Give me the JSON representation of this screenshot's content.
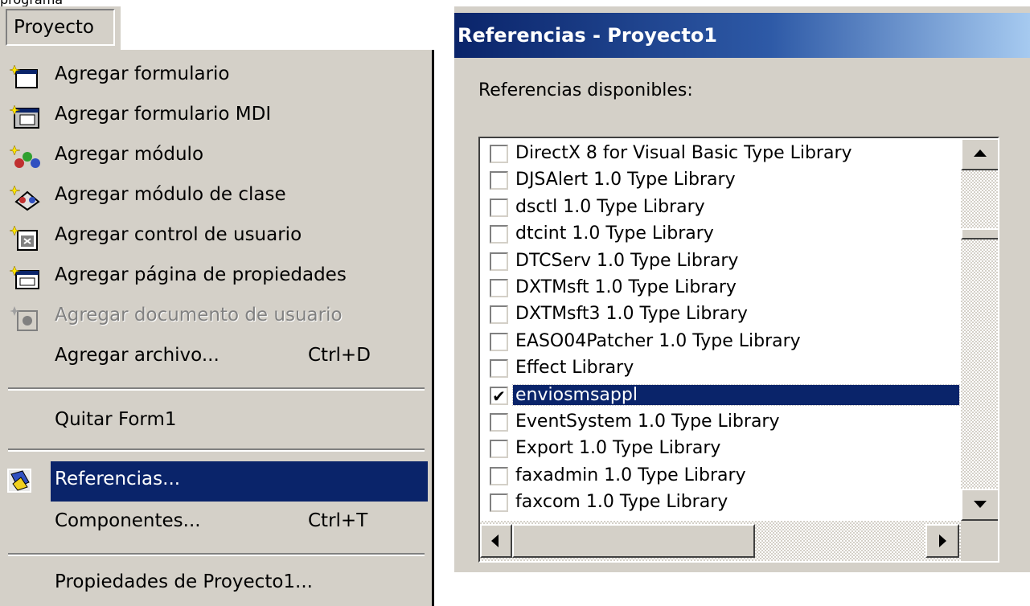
{
  "caption": "programa",
  "menubar": {
    "title": "Proyecto"
  },
  "menu": {
    "items": [
      {
        "label": "Agregar formulario",
        "icon": "add-form-icon"
      },
      {
        "label": "Agregar formulario MDI",
        "icon": "add-mdi-form-icon"
      },
      {
        "label": "Agregar módulo",
        "icon": "add-module-icon"
      },
      {
        "label": "Agregar módulo de clase",
        "icon": "add-class-module-icon"
      },
      {
        "label": "Agregar control de usuario",
        "icon": "add-user-control-icon"
      },
      {
        "label": "Agregar página de propiedades",
        "icon": "add-property-page-icon"
      },
      {
        "label": "Agregar documento de usuario",
        "icon": "add-user-document-icon",
        "disabled": true
      },
      {
        "label": "Agregar archivo...",
        "accel": "Ctrl+D"
      },
      {
        "label": "Quitar Form1"
      },
      {
        "label": "Referencias...",
        "icon": "references-icon",
        "selected": true
      },
      {
        "label": "Componentes...",
        "accel": "Ctrl+T"
      },
      {
        "label": "Propiedades de Proyecto1..."
      }
    ]
  },
  "dialog": {
    "title": "Referencias - Proyecto1",
    "available_label": "Referencias disponibles:",
    "references": [
      {
        "name": "DirectX 8 for Visual Basic Type Library",
        "checked": false
      },
      {
        "name": "DJSAlert 1.0 Type Library",
        "checked": false
      },
      {
        "name": "dsctl 1.0 Type Library",
        "checked": false
      },
      {
        "name": "dtcint 1.0 Type Library",
        "checked": false
      },
      {
        "name": "DTCServ 1.0 Type Library",
        "checked": false
      },
      {
        "name": "DXTMsft 1.0 Type Library",
        "checked": false
      },
      {
        "name": "DXTMsft3 1.0 Type Library",
        "checked": false
      },
      {
        "name": "EASO04Patcher 1.0 Type Library",
        "checked": false
      },
      {
        "name": "Effect Library",
        "checked": false
      },
      {
        "name": "enviosmsappl",
        "checked": true,
        "selected": true
      },
      {
        "name": "EventSystem 1.0 Type Library",
        "checked": false
      },
      {
        "name": "Export 1.0 Type Library",
        "checked": false
      },
      {
        "name": "faxadmin 1.0 Type Library",
        "checked": false
      },
      {
        "name": "faxcom 1.0 Type Library",
        "checked": false
      }
    ],
    "check_mark": "✔"
  },
  "colors": {
    "highlight": "#0a246a",
    "face": "#d4d0c8"
  }
}
